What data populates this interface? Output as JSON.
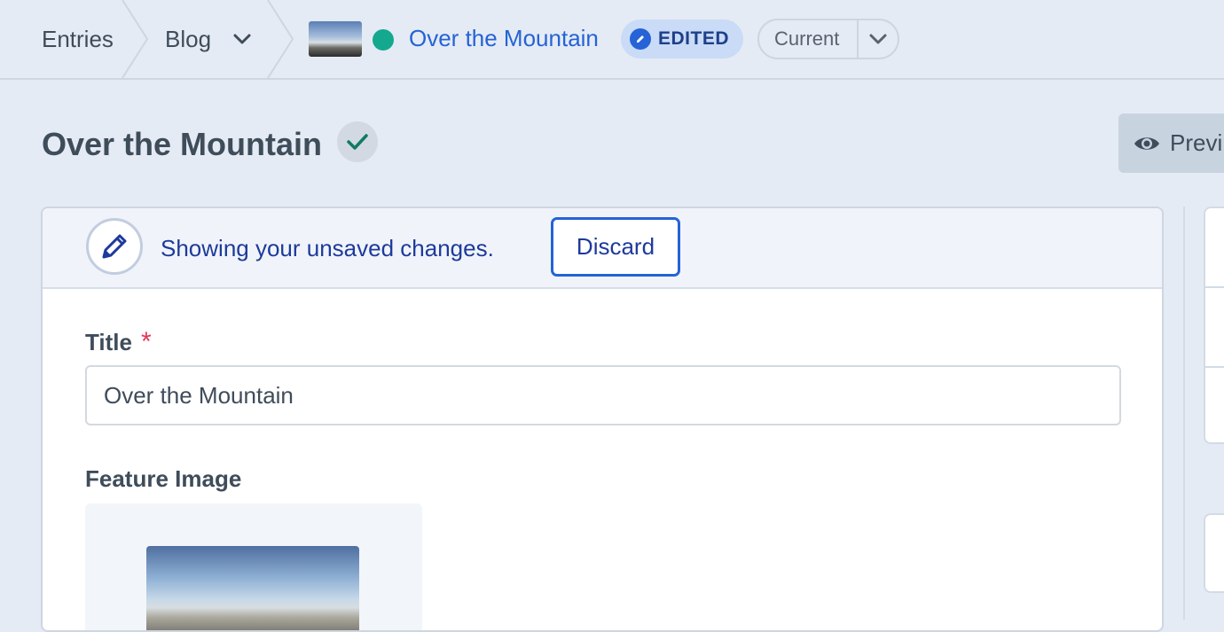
{
  "breadcrumb": {
    "entries_label": "Entries",
    "collection_label": "Blog",
    "entry_title": "Over the Mountain",
    "status_color": "#14a98f",
    "edited_badge": "EDITED",
    "revision_label": "Current"
  },
  "header": {
    "title": "Over the Mountain",
    "preview_label": "Previ"
  },
  "notice": {
    "message": "Showing your unsaved changes.",
    "discard_label": "Discard"
  },
  "fields": {
    "title_label": "Title",
    "required_mark": "*",
    "title_value": "Over the Mountain",
    "feature_image_label": "Feature Image"
  },
  "colors": {
    "accent": "#2563d6",
    "background": "#e4ebf4",
    "required": "#e5355a"
  }
}
